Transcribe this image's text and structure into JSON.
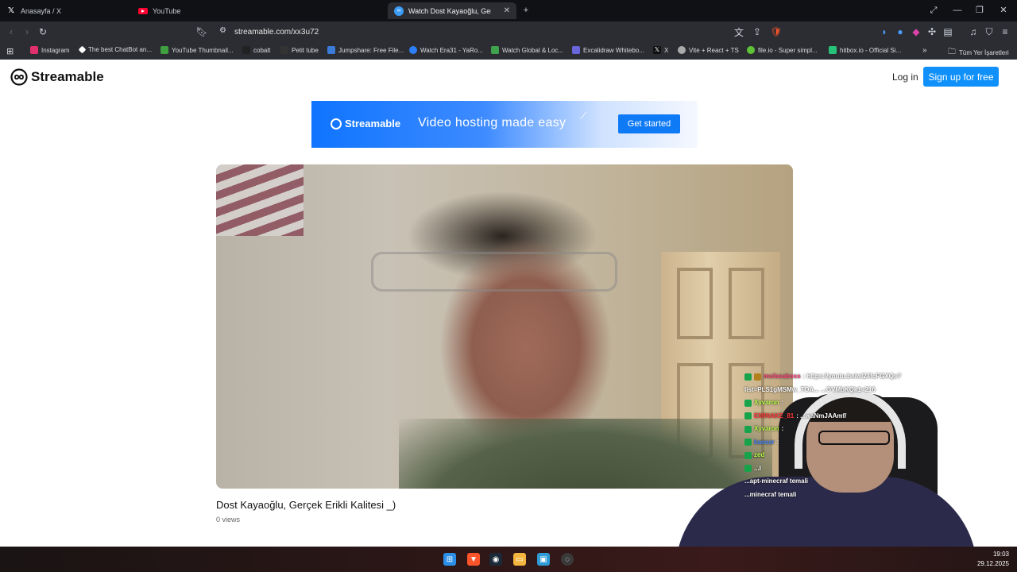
{
  "tabs": [
    {
      "title": "Anasayfa / X",
      "icon": "x-logo-icon"
    },
    {
      "title": "YouTube",
      "icon": "youtube-icon"
    },
    {
      "title": "Watch Dost Kayaoğlu, Gerçek",
      "icon": "streamable-icon",
      "active": true
    }
  ],
  "browser": {
    "url": "streamable.com/xx3u72",
    "shield_count": "2"
  },
  "bookmarks": [
    {
      "label": "Instagram",
      "color": "#e1306c"
    },
    {
      "label": "The best ChatBot an...",
      "color": "#ffffff"
    },
    {
      "label": "YouTube Thumbnail...",
      "color": "#3f9e3f"
    },
    {
      "label": "cobalt",
      "color": "#222222"
    },
    {
      "label": "Petit tube",
      "color": "#333333"
    },
    {
      "label": "Jumpshare: Free File...",
      "color": "#3b7bd8"
    },
    {
      "label": "Watch Era31 - YaRo...",
      "color": "#2d7ff9"
    },
    {
      "label": "Watch Global & Loc...",
      "color": "#3fa34d"
    },
    {
      "label": "Excalidraw Whitebo...",
      "color": "#6965db"
    },
    {
      "label": "X",
      "color": "#111111"
    },
    {
      "label": "Vite + React + TS",
      "color": "#aaaaaa"
    },
    {
      "label": "file.io - Super simpl...",
      "color": "#5fc337"
    },
    {
      "label": "hitbox.io - Official Si...",
      "color": "#27c27a"
    }
  ],
  "bookmarks_more": "»",
  "bookmarks_all": "Tüm Yer İşaretleri",
  "site": {
    "brand": "Streamable",
    "login": "Log in",
    "signup": "Sign up for free"
  },
  "banner": {
    "brand": "Streamable",
    "tagline": "Video hosting made easy",
    "cta": "Get started"
  },
  "video": {
    "title": "Dost Kayaoğlu, Gerçek Erikli Kalitesi _)",
    "views": "0 views"
  },
  "chat": [
    {
      "user": "mufasaboss",
      "user_color": "#ff4a7d",
      "text": ": https://youtu.be/wl24fcFGXQs?"
    },
    {
      "user": "",
      "user_color": "#ffffff",
      "text": "list=PLS1gMSMw_TOA...                  ...OVMbKQk1=216"
    },
    {
      "user": "Xyvaron",
      "user_color": "#b7ff4a",
      "text": ": "
    },
    {
      "user": "EMINAKE_81",
      "user_color": "#ff3a3a",
      "text": ":                        ...waNmJAAmf/"
    },
    {
      "user": "Xyvaron",
      "user_color": "#b7ff4a",
      "text": ": "
    },
    {
      "user": "kaosxr",
      "user_color": "#4a8bff",
      "text": ": "
    },
    {
      "user": "zed",
      "user_color": "#b7ff4a",
      "text": ""
    },
    {
      "user": "",
      "user_color": "#ffffff",
      "text": "...l"
    },
    {
      "user": "",
      "user_color": "#ffffff",
      "text": "                                        ...apt-minecraf temali"
    },
    {
      "user": "",
      "user_color": "#ffffff",
      "text": ""
    },
    {
      "user": "",
      "user_color": "#ffffff",
      "text": "                                        ...minecraf temali"
    }
  ],
  "taskbar": {
    "time": "19:03",
    "date": "29.12.2025"
  }
}
